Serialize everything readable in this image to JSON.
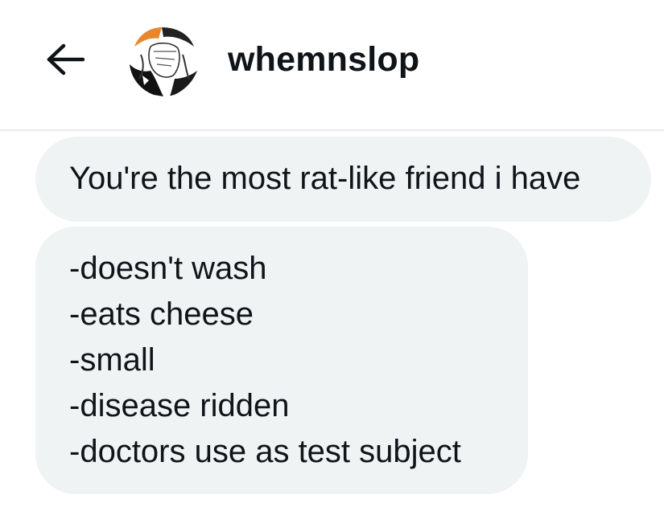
{
  "header": {
    "back_icon": "arrow-left-icon",
    "username": "whemnslop"
  },
  "messages": [
    {
      "text": "You're the most rat-like friend i have"
    },
    {
      "lines": [
        "-doesn't wash",
        "-eats cheese",
        "-small",
        "-disease ridden",
        "-doctors use as test subject"
      ]
    }
  ],
  "colors": {
    "bubble_background": "#eff3f4",
    "text": "#0f1419",
    "divider": "#e7e9ea",
    "avatar_accent": "#e8872c"
  }
}
